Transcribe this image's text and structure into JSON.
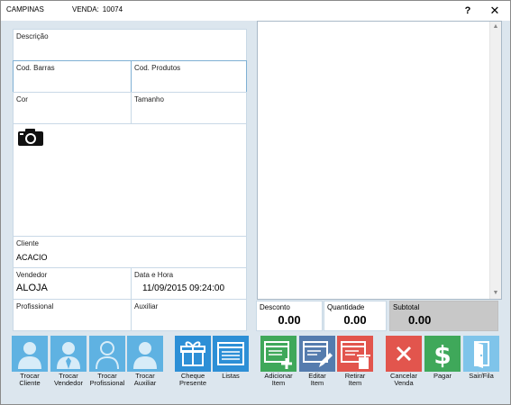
{
  "window": {
    "app_name": "CAMPINAS",
    "venda_label": "VENDA:",
    "venda_number": "10074",
    "help_label": "?",
    "close_label": "✕"
  },
  "form": {
    "descricao": {
      "label": "Descrição",
      "value": ""
    },
    "cod_barras": {
      "label": "Cod. Barras",
      "value": ""
    },
    "cod_produtos": {
      "label": "Cod. Produtos",
      "value": ""
    },
    "cor": {
      "label": "Cor",
      "value": ""
    },
    "tamanho": {
      "label": "Tamanho",
      "value": ""
    },
    "camera_icon": "camera-icon",
    "cliente": {
      "label": "Cliente",
      "value": "ACACIO"
    },
    "vendedor": {
      "label": "Vendedor",
      "value": "ALOJA"
    },
    "data_hora": {
      "label": "Data e Hora",
      "value": "11/09/2015 09:24:00"
    },
    "profissional": {
      "label": "Profissional",
      "value": ""
    },
    "auxiliar": {
      "label": "Auxiliar",
      "value": ""
    }
  },
  "totals": {
    "desconto": {
      "label": "Desconto",
      "value": "0.00"
    },
    "quantidade": {
      "label": "Quantidade",
      "value": "0.00"
    },
    "subtotal": {
      "label": "Subtotal",
      "value": "0.00"
    }
  },
  "toolbar": {
    "trocar_cliente": {
      "line1": "Trocar",
      "line2": "Cliente",
      "icon": "person-icon",
      "color": "#5fb2e2"
    },
    "trocar_vendedor": {
      "line1": "Trocar",
      "line2": "Vendedor",
      "icon": "person-tie-icon",
      "color": "#5fb2e2"
    },
    "trocar_profissional": {
      "line1": "Trocar",
      "line2": "Profissional",
      "icon": "person-outline-icon",
      "color": "#5fb2e2"
    },
    "trocar_auxiliar": {
      "line1": "Trocar",
      "line2": "Auxiliar",
      "icon": "person-icon",
      "color": "#5fb2e2"
    },
    "cheque_presente": {
      "line1": "Cheque",
      "line2": "Presente",
      "icon": "gift-icon",
      "color": "#2d8fd6"
    },
    "listas": {
      "line1": "Listas",
      "line2": "",
      "icon": "list-icon",
      "color": "#2d8fd6"
    },
    "adicionar_item": {
      "line1": "Adicionar",
      "line2": "Item",
      "icon": "add-item-icon",
      "color": "#3fa85a"
    },
    "editar_item": {
      "line1": "Editar",
      "line2": "Item",
      "icon": "edit-item-icon",
      "color": "#557cae"
    },
    "retirar_item": {
      "line1": "Retirar",
      "line2": "Item",
      "icon": "remove-item-icon",
      "color": "#e2554d"
    },
    "cancelar_venda": {
      "line1": "Cancelar",
      "line2": "Venda",
      "icon": "x-icon",
      "color": "#e2554d"
    },
    "pagar": {
      "line1": "Pagar",
      "line2": "",
      "icon": "dollar-icon",
      "color": "#3fa85a"
    },
    "sair_fila": {
      "line1": "Sair/Fila",
      "line2": "",
      "icon": "door-icon",
      "color": "#7fc4ea"
    }
  }
}
